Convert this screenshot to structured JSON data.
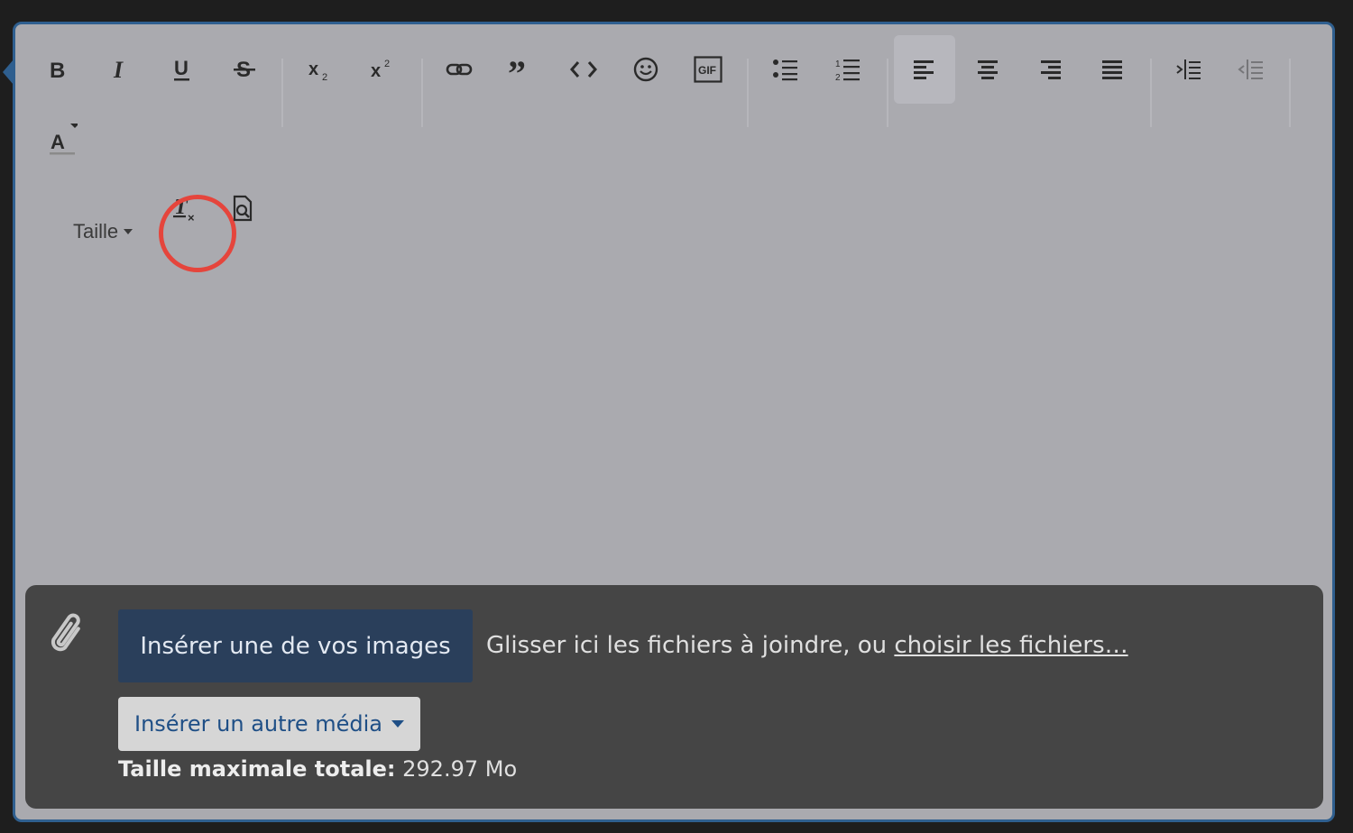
{
  "toolbar": {
    "size_label": "Taille",
    "gif_label": "GIF",
    "strike_label": "S"
  },
  "attachments": {
    "insert_images_label": "Insérer une de vos images",
    "drop_text": "Glisser ici les fichiers à joindre, ou",
    "choose_files_link": "choisir les fichiers…",
    "insert_media_label": "Insérer un autre média",
    "max_size_label": "Taille maximale totale:",
    "max_size_value": "292.97 Mo"
  },
  "colors": {
    "editor_bg": "#aaaaaf",
    "editor_border": "#2f5f8f",
    "attach_bg": "#454545",
    "primary_button": "#2a3f5b",
    "highlight": "#e5453c",
    "link_blue": "#1f4f86"
  }
}
